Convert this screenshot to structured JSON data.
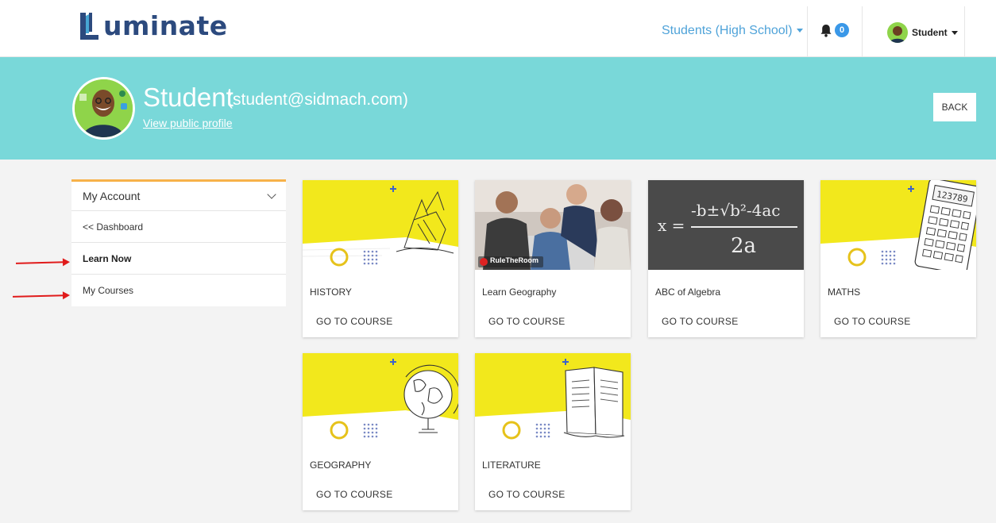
{
  "header": {
    "logo_text": "uminate",
    "role_selector": "Students (High School)",
    "notification_count": "0",
    "user_menu_label": "Student"
  },
  "profile": {
    "name": "Student",
    "email": "(student@sidmach.com)",
    "public_profile_link": "View public profile",
    "back_button": "BACK"
  },
  "sidebar": {
    "title": "My Account",
    "items": [
      {
        "label": "<< Dashboard"
      },
      {
        "label": "Learn Now"
      },
      {
        "label": "My Courses"
      }
    ]
  },
  "courses": [
    {
      "title": "HISTORY",
      "action": "GO TO COURSE",
      "image": "sinking-ship-sketch"
    },
    {
      "title": "Learn Geography",
      "action": "GO TO COURSE",
      "image": "students-classroom-photo",
      "watermark": "RuleTheRoom"
    },
    {
      "title": "ABC of Algebra",
      "action": "GO TO COURSE",
      "image": "quadratic-formula-chalkboard",
      "formula_lhs": "x =",
      "formula_num": "-b±√b²-4ac",
      "formula_den": "2a"
    },
    {
      "title": "MATHS",
      "action": "GO TO COURSE",
      "image": "calculator-sketch",
      "calc_display": "123789"
    },
    {
      "title": "GEOGRAPHY",
      "action": "GO TO COURSE",
      "image": "globe-sketch"
    },
    {
      "title": "LITERATURE",
      "action": "GO TO COURSE",
      "image": "open-book-sketch"
    }
  ],
  "colors": {
    "banner": "#79d8d9",
    "accent_blue": "#4fa3d9",
    "card_yellow": "#f2e81c",
    "sidebar_accent": "#f7b24a",
    "annotation_arrow": "#e01b1b"
  }
}
